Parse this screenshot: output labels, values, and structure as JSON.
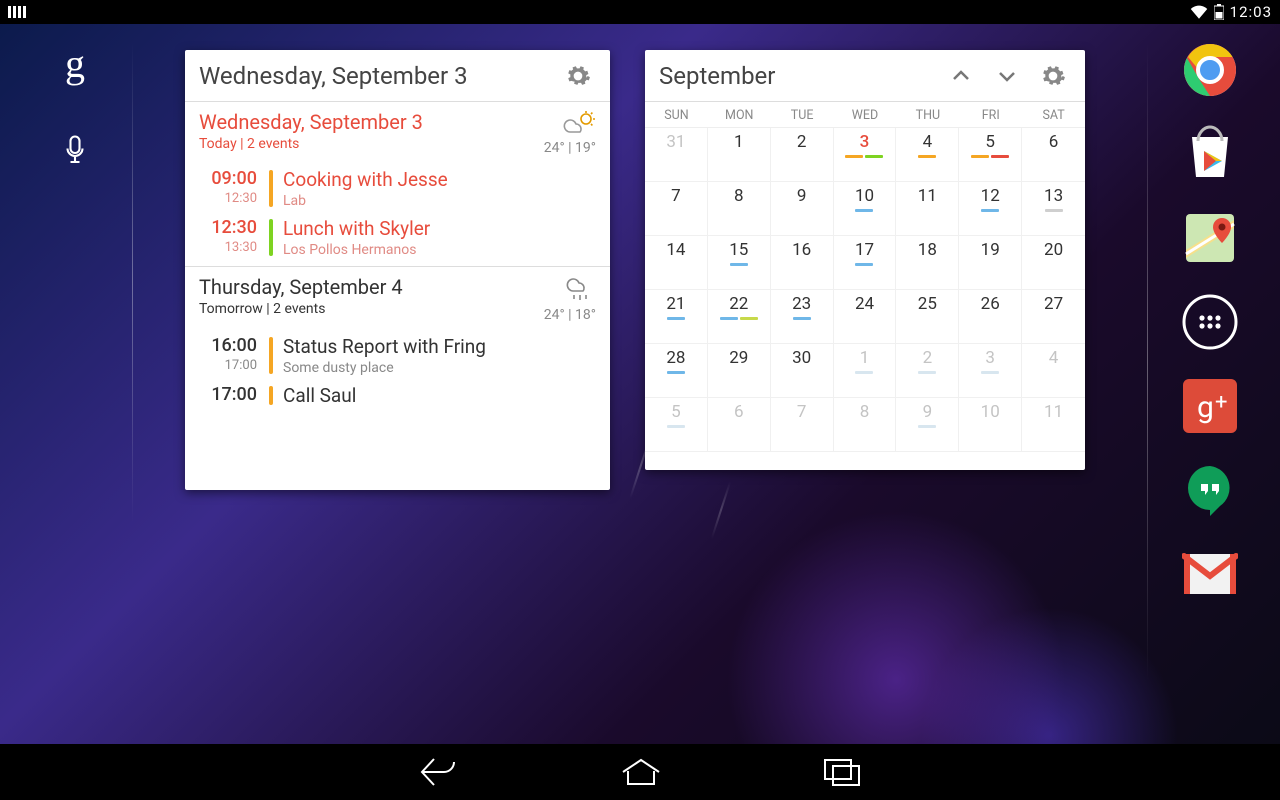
{
  "status": {
    "clock": "12:03"
  },
  "agenda": {
    "title": "Wednesday, September 3",
    "days": [
      {
        "date": "Wednesday, September 3",
        "sub": "Today | 2 events",
        "today": true,
        "weather": {
          "icon": "partly-cloudy",
          "hi": "24°",
          "lo": "19°"
        },
        "events": [
          {
            "start": "09:00",
            "end": "12:30",
            "title": "Cooking with Jesse",
            "loc": "Lab",
            "color": "#f5a623"
          },
          {
            "start": "12:30",
            "end": "13:30",
            "title": "Lunch with Skyler",
            "loc": "Los Pollos Hermanos",
            "color": "#7ed321"
          }
        ]
      },
      {
        "date": "Thursday, September 4",
        "sub": "Tomorrow | 2 events",
        "today": false,
        "weather": {
          "icon": "rain",
          "hi": "24°",
          "lo": "18°"
        },
        "events": [
          {
            "start": "16:00",
            "end": "17:00",
            "title": "Status Report with Fring",
            "loc": "Some dusty place",
            "color": "#f5a623"
          },
          {
            "start": "17:00",
            "end": "",
            "title": "Call Saul",
            "loc": "",
            "color": "#f5a623"
          }
        ]
      }
    ]
  },
  "month": {
    "title": "September",
    "dow": [
      "SUN",
      "MON",
      "TUE",
      "WED",
      "THU",
      "FRI",
      "SAT"
    ],
    "cells": [
      {
        "n": 31,
        "out": true
      },
      {
        "n": 1
      },
      {
        "n": 2
      },
      {
        "n": 3,
        "today": true,
        "marks": [
          "#f5a623",
          "#7ed321"
        ]
      },
      {
        "n": 4,
        "marks": [
          "#f5a623"
        ]
      },
      {
        "n": 5,
        "marks": [
          "#f5a623",
          "#e74c3c"
        ]
      },
      {
        "n": 6
      },
      {
        "n": 7
      },
      {
        "n": 8
      },
      {
        "n": 9
      },
      {
        "n": 10,
        "marks": [
          "#6fb7e8"
        ]
      },
      {
        "n": 11
      },
      {
        "n": 12,
        "marks": [
          "#6fb7e8"
        ]
      },
      {
        "n": 13,
        "marks": [
          "#cfcfcf"
        ]
      },
      {
        "n": 14
      },
      {
        "n": 15,
        "marks": [
          "#6fb7e8"
        ]
      },
      {
        "n": 16
      },
      {
        "n": 17,
        "marks": [
          "#6fb7e8"
        ]
      },
      {
        "n": 18
      },
      {
        "n": 19
      },
      {
        "n": 20
      },
      {
        "n": 21,
        "marks": [
          "#6fb7e8"
        ]
      },
      {
        "n": 22,
        "marks": [
          "#6fb7e8",
          "#c7d94a"
        ]
      },
      {
        "n": 23,
        "marks": [
          "#6fb7e8"
        ]
      },
      {
        "n": 24
      },
      {
        "n": 25
      },
      {
        "n": 26
      },
      {
        "n": 27
      },
      {
        "n": 28,
        "marks": [
          "#6fb7e8"
        ]
      },
      {
        "n": 29
      },
      {
        "n": 30
      },
      {
        "n": 1,
        "out": true,
        "marks": [
          "#d8e6ef"
        ]
      },
      {
        "n": 2,
        "out": true,
        "marks": [
          "#d8e6ef"
        ]
      },
      {
        "n": 3,
        "out": true,
        "marks": [
          "#d8e6ef"
        ]
      },
      {
        "n": 4,
        "out": true
      },
      {
        "n": 5,
        "out": true,
        "marks": [
          "#d8e6ef"
        ]
      },
      {
        "n": 6,
        "out": true
      },
      {
        "n": 7,
        "out": true
      },
      {
        "n": 8,
        "out": true
      },
      {
        "n": 9,
        "out": true,
        "marks": [
          "#d8e6ef"
        ]
      },
      {
        "n": 10,
        "out": true
      },
      {
        "n": 11,
        "out": true
      }
    ]
  },
  "apps": [
    "chrome",
    "play-store",
    "maps",
    "app-drawer",
    "google-plus",
    "hangouts",
    "gmail"
  ]
}
